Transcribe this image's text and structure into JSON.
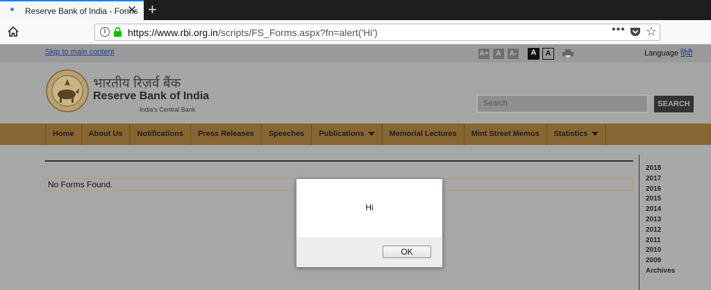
{
  "browser": {
    "tab_title": "Reserve Bank of India - Forms",
    "new_tab_symbol": "+",
    "close_symbol": "✕",
    "url_domain": "https://www.rbi.org.in",
    "url_path": "/scripts/FS_Forms.aspx?fn=alert('Hi')",
    "more_symbol": "•••",
    "star_symbol": "☆"
  },
  "topbar": {
    "skip_link": "Skip to main content",
    "font_sizes": [
      "A+",
      "A",
      "A-"
    ],
    "contrast": [
      "A",
      "A"
    ],
    "language_label": "Language",
    "language_link": "हिंदी"
  },
  "header": {
    "hindi_name": "भारतीय रिज़र्व बैंक",
    "english_name": "Reserve Bank of India",
    "tagline": "India's Central Bank",
    "search_placeholder": "Search",
    "search_button": "SEARCH"
  },
  "nav": {
    "items": [
      "Home",
      "About Us",
      "Notifications",
      "Press Releases",
      "Speeches",
      "Publications",
      "Memorial Lectures",
      "Mint Street Memos",
      "Statistics"
    ]
  },
  "content": {
    "no_forms": "No Forms Found.",
    "years": [
      "2018",
      "2017",
      "2016",
      "2015",
      "2014",
      "2013",
      "2012",
      "2011",
      "2010",
      "2009",
      "Archives"
    ]
  },
  "dialog": {
    "message": "Hi",
    "ok_label": "OK"
  },
  "colors": {
    "nav_bg": "#876632",
    "tab_accent": "#0a84ff",
    "lock_green": "#12bc00"
  }
}
